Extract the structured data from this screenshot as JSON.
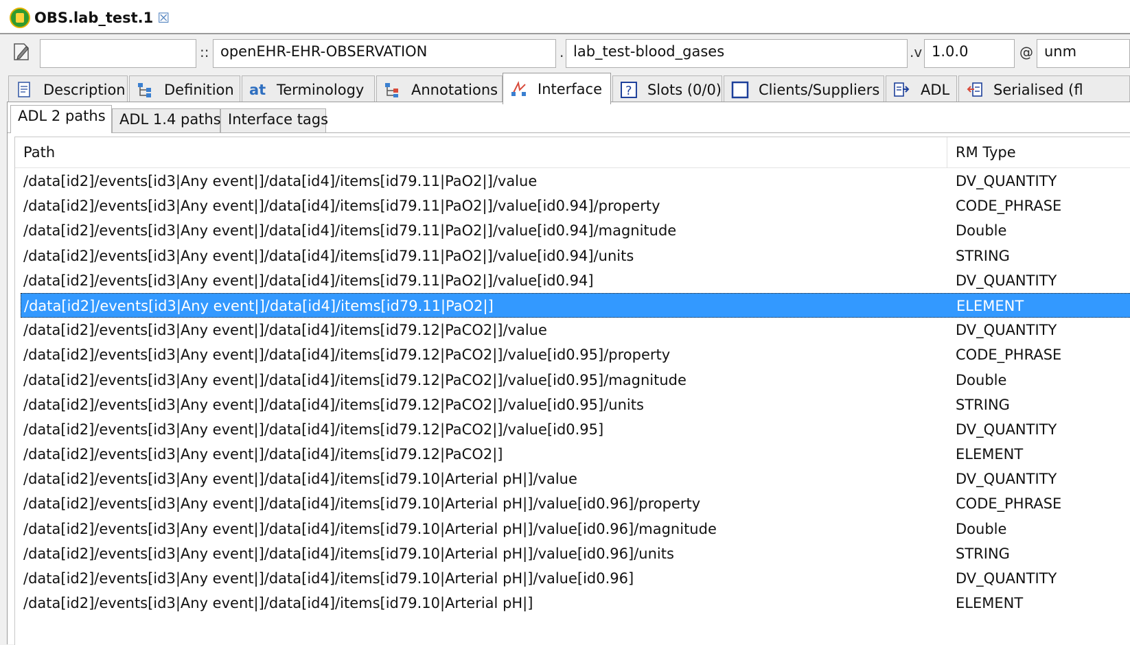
{
  "document_tab": {
    "title": "OBS.lab_test.1",
    "close_icon": "close-icon"
  },
  "toolbar": {
    "edit_icon": "edit-document-icon",
    "namespace_value": "",
    "separator1": "::",
    "rm_type_value": "openEHR-EHR-OBSERVATION",
    "separator2": ".",
    "concept_value": "lab_test-blood_gases",
    "separator3": ".v",
    "version_value": "1.0.0",
    "separator4": "@",
    "status_value": "unm"
  },
  "view_tabs": [
    {
      "label": "Description",
      "icon": "description-icon",
      "active": false
    },
    {
      "label": "Definition",
      "icon": "definition-tree-icon",
      "active": false
    },
    {
      "label": "Terminology",
      "icon": "terminology-icon",
      "active": false
    },
    {
      "label": "Annotations",
      "icon": "annotations-icon",
      "active": false
    },
    {
      "label": "Interface",
      "icon": "interface-icon",
      "active": true
    },
    {
      "label": "Slots (0/0)",
      "icon": "slots-help-icon",
      "active": false
    },
    {
      "label": "Clients/Suppliers",
      "icon": "clients-suppliers-icon",
      "active": false
    },
    {
      "label": "ADL",
      "icon": "adl-icon",
      "active": false
    },
    {
      "label": "Serialised (fl",
      "icon": "serialised-icon",
      "active": false
    }
  ],
  "sub_tabs": [
    {
      "label": "ADL 2 paths",
      "active": true
    },
    {
      "label": "ADL 1.4 paths",
      "active": false
    },
    {
      "label": "Interface tags",
      "active": false
    }
  ],
  "table": {
    "columns": [
      "Path",
      "RM Type"
    ],
    "rows": [
      [
        "/data[id2]/events[id3|Any event|]/data[id4]/items[id79.11|PaO2|]/value",
        "DV_QUANTITY"
      ],
      [
        "/data[id2]/events[id3|Any event|]/data[id4]/items[id79.11|PaO2|]/value[id0.94]/property",
        "CODE_PHRASE"
      ],
      [
        "/data[id2]/events[id3|Any event|]/data[id4]/items[id79.11|PaO2|]/value[id0.94]/magnitude",
        "Double"
      ],
      [
        "/data[id2]/events[id3|Any event|]/data[id4]/items[id79.11|PaO2|]/value[id0.94]/units",
        "STRING"
      ],
      [
        "/data[id2]/events[id3|Any event|]/data[id4]/items[id79.11|PaO2|]/value[id0.94]",
        "DV_QUANTITY"
      ],
      [
        "/data[id2]/events[id3|Any event|]/data[id4]/items[id79.11|PaO2|]",
        "ELEMENT"
      ],
      [
        "/data[id2]/events[id3|Any event|]/data[id4]/items[id79.12|PaCO2|]/value",
        "DV_QUANTITY"
      ],
      [
        "/data[id2]/events[id3|Any event|]/data[id4]/items[id79.12|PaCO2|]/value[id0.95]/property",
        "CODE_PHRASE"
      ],
      [
        "/data[id2]/events[id3|Any event|]/data[id4]/items[id79.12|PaCO2|]/value[id0.95]/magnitude",
        "Double"
      ],
      [
        "/data[id2]/events[id3|Any event|]/data[id4]/items[id79.12|PaCO2|]/value[id0.95]/units",
        "STRING"
      ],
      [
        "/data[id2]/events[id3|Any event|]/data[id4]/items[id79.12|PaCO2|]/value[id0.95]",
        "DV_QUANTITY"
      ],
      [
        "/data[id2]/events[id3|Any event|]/data[id4]/items[id79.12|PaCO2|]",
        "ELEMENT"
      ],
      [
        "/data[id2]/events[id3|Any event|]/data[id4]/items[id79.10|Arterial pH|]/value",
        "DV_QUANTITY"
      ],
      [
        "/data[id2]/events[id3|Any event|]/data[id4]/items[id79.10|Arterial pH|]/value[id0.96]/property",
        "CODE_PHRASE"
      ],
      [
        "/data[id2]/events[id3|Any event|]/data[id4]/items[id79.10|Arterial pH|]/value[id0.96]/magnitude",
        "Double"
      ],
      [
        "/data[id2]/events[id3|Any event|]/data[id4]/items[id79.10|Arterial pH|]/value[id0.96]/units",
        "STRING"
      ],
      [
        "/data[id2]/events[id3|Any event|]/data[id4]/items[id79.10|Arterial pH|]/value[id0.96]",
        "DV_QUANTITY"
      ],
      [
        "/data[id2]/events[id3|Any event|]/data[id4]/items[id79.10|Arterial pH|]",
        "ELEMENT"
      ]
    ],
    "selected_row": 5
  }
}
